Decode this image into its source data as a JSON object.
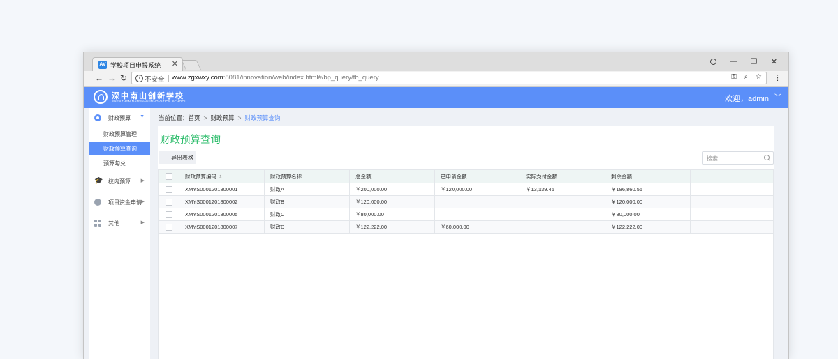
{
  "browser": {
    "tab_title": "学校项目申报系统",
    "favicon_text": "AV",
    "insecure_label": "不安全",
    "url_host": "www.zgxwxy.com",
    "url_path": ":8081/innovation/web/index.html#/bp_query/fb_query"
  },
  "header": {
    "logo_cn": "深中南山创新学校",
    "logo_en": "SHENZHEN NANSHAN INNOVATION SCHOOL",
    "welcome": "欢迎，admin",
    "accent": "#5b8ff9"
  },
  "sidebar": {
    "groups": [
      {
        "label": "财政预算",
        "icon": "budget-icon",
        "expanded": true,
        "items": [
          {
            "label": "财政预算管理"
          },
          {
            "label": "财政预算查询",
            "active": true
          },
          {
            "label": "预算勾兑"
          }
        ]
      },
      {
        "label": "校内预算",
        "icon": "graduation-cap-icon"
      },
      {
        "label": "项目资金申请",
        "icon": "chart-icon"
      },
      {
        "label": "其他",
        "icon": "grid-icon"
      }
    ]
  },
  "breadcrumb": {
    "prefix": "当前位置：",
    "items": [
      "首页",
      "财政预算",
      "财政预算查询"
    ]
  },
  "main": {
    "title": "财政预算查询",
    "title_color": "#2ebd6c",
    "export_label": "导出表格",
    "search_placeholder": "搜索",
    "columns": [
      "财政预算编码",
      "财政预算名称",
      "总金额",
      "已申请金额",
      "实际支付金额",
      "剩余金额"
    ],
    "rows": [
      {
        "code": "XMYS0001201800001",
        "name": "财政A",
        "total": "￥200,000.00",
        "applied": "￥120,000.00",
        "paid": "￥13,139.45",
        "remaining": "￥186,860.55"
      },
      {
        "code": "XMYS0001201800002",
        "name": "财政B",
        "total": "￥120,000.00",
        "applied": "",
        "paid": "",
        "remaining": "￥120,000.00"
      },
      {
        "code": "XMYS0001201800005",
        "name": "财政C",
        "total": "￥80,000.00",
        "applied": "",
        "paid": "",
        "remaining": "￥80,000.00"
      },
      {
        "code": "XMYS0001201800007",
        "name": "财政D",
        "total": "￥122,222.00",
        "applied": "￥60,000.00",
        "paid": "",
        "remaining": "￥122,222.00"
      }
    ]
  }
}
